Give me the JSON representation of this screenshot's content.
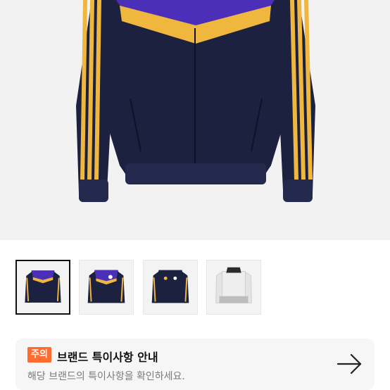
{
  "product": {
    "hero_image": "track-jacket-main",
    "colors": {
      "navy": "#1c2140",
      "purple": "#4b2fb8",
      "gold": "#f0b73f",
      "light_bg": "#f2f2f2"
    }
  },
  "gallery": {
    "thumbnails": [
      {
        "name": "thumb-front-navy-purple",
        "selected": true
      },
      {
        "name": "thumb-front-crest"
      },
      {
        "name": "thumb-navy-crest"
      },
      {
        "name": "thumb-white-grey"
      }
    ]
  },
  "notice": {
    "badge": "주의",
    "title": "브랜드 특이사항 안내",
    "subtitle": "해당 브랜드의 특이사항을 확인하세요.",
    "icon": "arrow-right-icon",
    "colors": {
      "badge_bg": "#ff6c2f",
      "card_bg": "#f6f6f6"
    }
  }
}
